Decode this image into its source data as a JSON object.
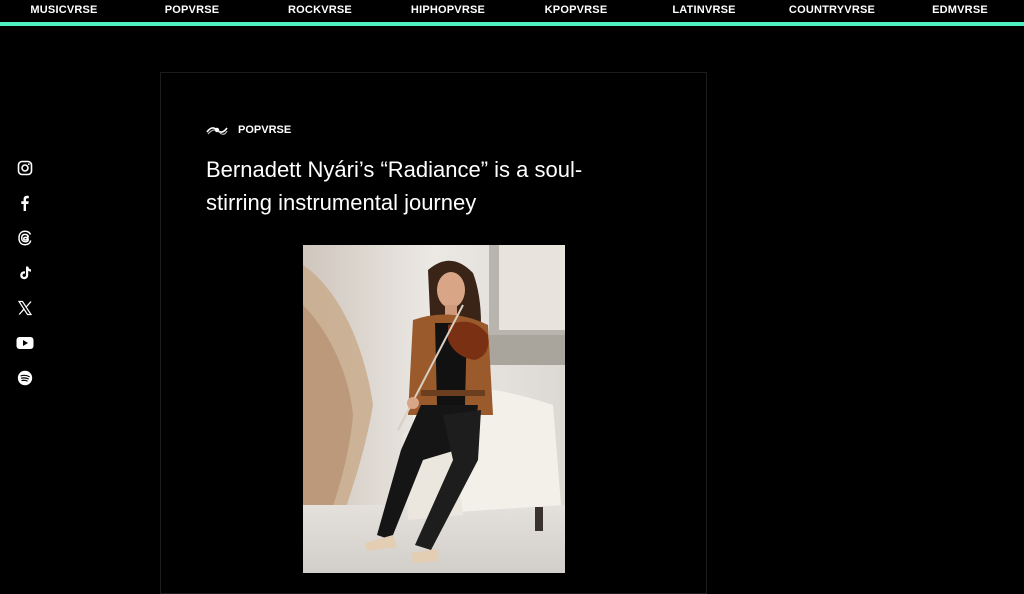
{
  "nav": {
    "items": [
      "MUSICVRSE",
      "POPVRSE",
      "ROCKVRSE",
      "HIPHOPVRSE",
      "KPOPVRSE",
      "LATINVRSE",
      "COUNTRYVRSE",
      "EDMVRSE"
    ]
  },
  "social": {
    "icons": [
      "instagram-icon",
      "facebook-icon",
      "threads-icon",
      "tiktok-icon",
      "x-icon",
      "youtube-icon",
      "spotify-icon"
    ]
  },
  "article": {
    "category": "POPVRSE",
    "title": "Bernadett Nyári’s “Radiance” is a soul-stirring instrumental journey"
  },
  "colors": {
    "accent": "#4df0c0",
    "background": "#000000"
  }
}
